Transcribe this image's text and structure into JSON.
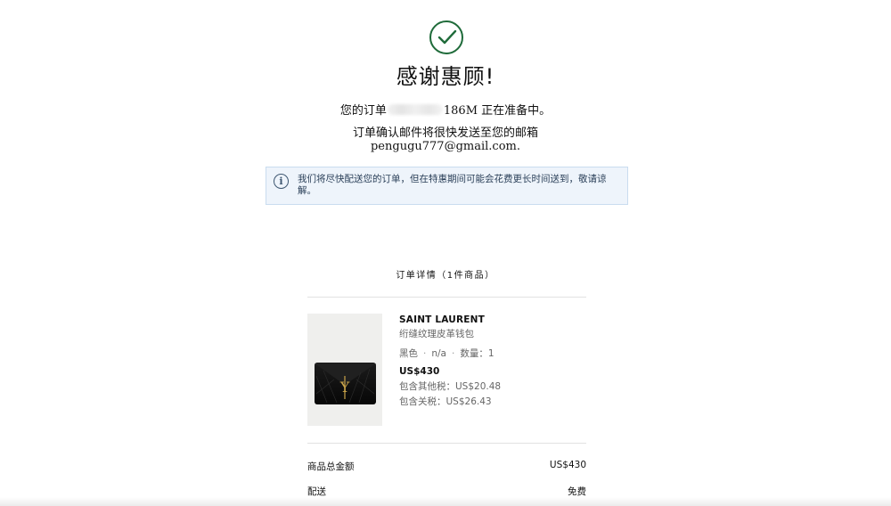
{
  "confirmation": {
    "icon": "checkmark-circle-icon",
    "title": "感谢惠顾!",
    "order_prefix": "您的订单",
    "order_suffix": "186M 正在准备中。",
    "email_notice": "订单确认邮件将很快发送至您的邮箱",
    "email": "pengugu777@gmail.com."
  },
  "info_banner": {
    "icon": "info-icon",
    "text": "我们将尽快配送您的订单，但在特惠期间可能会花费更长时间送到，敬请谅解。"
  },
  "order_details": {
    "heading": "订单详情（1件商品）",
    "item": {
      "image": "black-ysl-quilted-wallet",
      "brand": "SAINT LAURENT",
      "name": "绗缝纹理皮革钱包",
      "color": "黑色",
      "size": "n/a",
      "quantity": "数量：1",
      "price": "US$430",
      "other_tax": "包含其他税：US$20.48",
      "customs_tax": "包含关税：US$26.43"
    }
  },
  "summary": {
    "subtotal_label": "商品总金额",
    "subtotal_value": "US$430",
    "shipping_label": "配送",
    "shipping_value": "免费"
  },
  "colors": {
    "success_green": "#1f6b3a",
    "info_background": "#eef4fb",
    "info_border": "#c9dcef"
  }
}
